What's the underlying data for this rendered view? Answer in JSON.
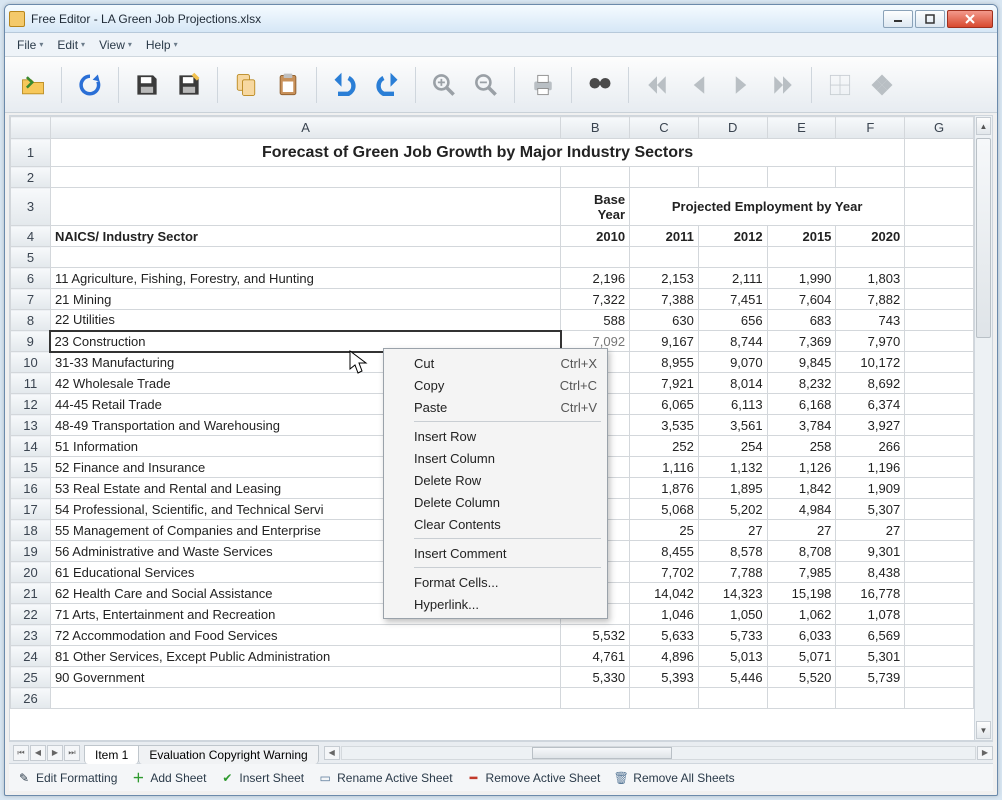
{
  "window": {
    "title": "Free Editor - LA Green Job Projections.xlsx"
  },
  "menubar": [
    "File",
    "Edit",
    "View",
    "Help"
  ],
  "columns": [
    "",
    "A",
    "B",
    "C",
    "D",
    "E",
    "F",
    "G"
  ],
  "sheet": {
    "title": "Forecast of Green Job Growth by Major Industry Sectors",
    "base_year_label": "Base Year",
    "proj_label": "Projected Employment by Year",
    "row4_label": "NAICS/ Industry Sector",
    "years": {
      "b": "2010",
      "c": "2011",
      "d": "2012",
      "e": "2015",
      "f": "2020"
    },
    "rows": [
      {
        "n": "6",
        "a": "11 Agriculture, Fishing, Forestry, and Hunting",
        "b": "2,196",
        "c": "2,153",
        "d": "2,111",
        "e": "1,990",
        "f": "1,803"
      },
      {
        "n": "7",
        "a": "21 Mining",
        "b": "7,322",
        "c": "7,388",
        "d": "7,451",
        "e": "7,604",
        "f": "7,882"
      },
      {
        "n": "8",
        "a": "22 Utilities",
        "b": "588",
        "c": "630",
        "d": "656",
        "e": "683",
        "f": "743"
      },
      {
        "n": "9",
        "a": "23 Construction",
        "b": "7,092",
        "c": "9,167",
        "d": "8,744",
        "e": "7,369",
        "f": "7,970",
        "selected": true,
        "hideB": true
      },
      {
        "n": "10",
        "a": "31-33 Manufacturing",
        "b": "",
        "c": "8,955",
        "d": "9,070",
        "e": "9,845",
        "f": "10,172"
      },
      {
        "n": "11",
        "a": "42 Wholesale Trade",
        "b": "",
        "c": "7,921",
        "d": "8,014",
        "e": "8,232",
        "f": "8,692"
      },
      {
        "n": "12",
        "a": "44-45 Retail Trade",
        "b": "",
        "c": "6,065",
        "d": "6,113",
        "e": "6,168",
        "f": "6,374"
      },
      {
        "n": "13",
        "a": "48-49 Transportation and Warehousing",
        "b": "",
        "c": "3,535",
        "d": "3,561",
        "e": "3,784",
        "f": "3,927"
      },
      {
        "n": "14",
        "a": "51 Information",
        "b": "",
        "c": "252",
        "d": "254",
        "e": "258",
        "f": "266"
      },
      {
        "n": "15",
        "a": "52 Finance and Insurance",
        "b": "",
        "c": "1,116",
        "d": "1,132",
        "e": "1,126",
        "f": "1,196"
      },
      {
        "n": "16",
        "a": "53 Real Estate and Rental and Leasing",
        "b": "",
        "c": "1,876",
        "d": "1,895",
        "e": "1,842",
        "f": "1,909"
      },
      {
        "n": "17",
        "a": "54 Professional, Scientific, and Technical Servi",
        "b": "",
        "c": "5,068",
        "d": "5,202",
        "e": "4,984",
        "f": "5,307"
      },
      {
        "n": "18",
        "a": "55 Management of Companies and Enterprise",
        "b": "",
        "c": "25",
        "d": "27",
        "e": "27",
        "f": "27"
      },
      {
        "n": "19",
        "a": "56 Administrative and Waste Services",
        "b": "",
        "c": "8,455",
        "d": "8,578",
        "e": "8,708",
        "f": "9,301"
      },
      {
        "n": "20",
        "a": "61 Educational Services",
        "b": "",
        "c": "7,702",
        "d": "7,788",
        "e": "7,985",
        "f": "8,438"
      },
      {
        "n": "21",
        "a": "62 Health Care and Social Assistance",
        "b": "",
        "c": "14,042",
        "d": "14,323",
        "e": "15,198",
        "f": "16,778"
      },
      {
        "n": "22",
        "a": "71 Arts, Entertainment and Recreation",
        "b": "",
        "c": "1,046",
        "d": "1,050",
        "e": "1,062",
        "f": "1,078"
      },
      {
        "n": "23",
        "a": "72 Accommodation and Food Services",
        "b": "5,532",
        "c": "5,633",
        "d": "5,733",
        "e": "6,033",
        "f": "6,569"
      },
      {
        "n": "24",
        "a": "81 Other Services, Except Public Administration",
        "b": "4,761",
        "c": "4,896",
        "d": "5,013",
        "e": "5,071",
        "f": "5,301"
      },
      {
        "n": "25",
        "a": "90 Government",
        "b": "5,330",
        "c": "5,393",
        "d": "5,446",
        "e": "5,520",
        "f": "5,739"
      },
      {
        "n": "26",
        "a": "",
        "b": "",
        "c": "",
        "d": "",
        "e": "",
        "f": ""
      }
    ]
  },
  "tabs": {
    "active": "Item 1",
    "other": "Evaluation Copyright Warning"
  },
  "status": {
    "edit": "Edit Formatting",
    "add": "Add Sheet",
    "insert": "Insert Sheet",
    "rename": "Rename Active Sheet",
    "remove": "Remove Active Sheet",
    "removeall": "Remove All Sheets"
  },
  "context": {
    "cut": "Cut",
    "cut_k": "Ctrl+X",
    "copy": "Copy",
    "copy_k": "Ctrl+C",
    "paste": "Paste",
    "paste_k": "Ctrl+V",
    "ins_row": "Insert Row",
    "ins_col": "Insert Column",
    "del_row": "Delete Row",
    "del_col": "Delete Column",
    "clear": "Clear Contents",
    "comment": "Insert Comment",
    "format": "Format Cells...",
    "link": "Hyperlink..."
  }
}
